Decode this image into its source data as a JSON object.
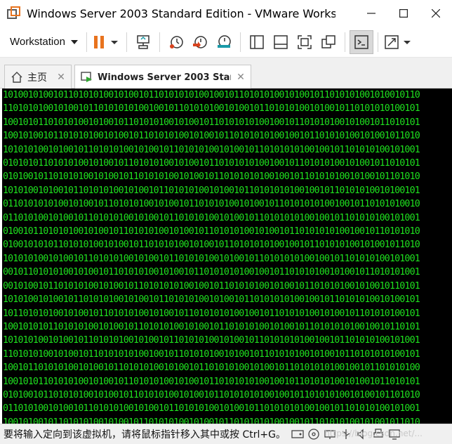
{
  "window": {
    "title": "Windows Server 2003 Standard Edition - VMware Workst..."
  },
  "toolbar": {
    "workstation_label": "Workstation"
  },
  "tabs": [
    {
      "label": "主页"
    },
    {
      "label": "Windows Server 2003 Stan..."
    }
  ],
  "console": {
    "lines": [
      "10100101001011010101001010010110101010100100101101010100101001011010101001010010110",
      "11010101001010010110101010100100101101010100101001011010101001010010110101010100101",
      "10010101101010100101001011010101001010010110101010100100101101010100101001011010101",
      "10010100101101010100101001011010101001010010110101010100100101101010100101001011010",
      "10101010010100101101010100101001011010101001010010110101010100100101101010100101001",
      "01010101101010100101001011010101001010010110101010100100101101010100101001011010101",
      "01010010110101010010100101101010100101001011010101010010010110101010010100101101010",
      "10101001010010110101010010100101101010100101001011010101010010010110101010010100101",
      "01101010101001010010110101010010100101101010100101001011010101010010010110101010010",
      "01101010010100101101010100101001011010101001010010110101010100100101101010100101001",
      "01001011010101001010010110101010010100101101010100101001011010101010010010110101010",
      "01001010101101010100101001011010101001010010110101010100100101101010100101001011010",
      "10101010010100101101010100101001011010101001010010110101010100100101101010100101001",
      "00101101010100101001011010101001010010110101010100100101101010100101001011010101001",
      "00101001011010101001010010110101010100100101101010100101001011010101001010010110101",
      "10101001010010110101010010100101101010100101001011010101010010010110101010010100101",
      "10110101010010100101101010100101001011010101010010010110101010010100101101010100101",
      "10010101011010101001010010110101010010100101101010100101001011010101010010010110101",
      "10101010010100101101010100101001011010101001010010110101010100100101101010100101001",
      "11010101001010010110101010100100101101010100101001011010101001010010110101010100101",
      "10010110101010010100101101010100101001011010101001010010110101010100100101101010100",
      "10010101101010100101001011010101001010010110101010100100101101010100101001011010101",
      "01010010110101010010100101101010100101001011010101010010010110101010010100101101010",
      "01101010010100101101010100101001011010101001010010110101010100100101101010100101001",
      "10010100101101010100101001011010101001010010110101010100100101101010100101001011010"
    ]
  },
  "statusbar": {
    "text": "要将输入定向到该虚拟机，请将鼠标指针移入其中或按 Ctrl+G。",
    "watermark": "https://blog.csdn.net/..."
  },
  "colors": {
    "console_bg": "#000000",
    "console_text": "#1ee01e",
    "pause_orange": "#e8731e",
    "snapshot_red": "#d9431e",
    "snapshot_teal": "#1a9aa8"
  }
}
